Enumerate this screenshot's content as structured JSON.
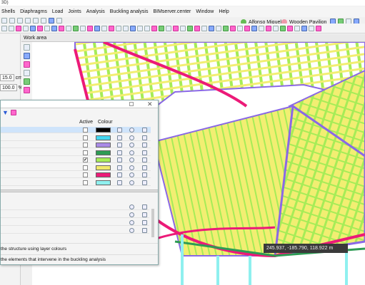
{
  "app": {
    "title_fragment": "3D)"
  },
  "menu": [
    "Shells",
    "Diaphragms",
    "Load",
    "Joints",
    "Analysis",
    "Buckling analysis",
    "BIMserver.center",
    "Window",
    "Help"
  ],
  "users": [
    {
      "name": "Alfonso Miguel",
      "color": "#7c6"
    },
    {
      "name": "Wooden Pavilion",
      "color": "#e9a"
    }
  ],
  "workarea": {
    "label": "Work area"
  },
  "left_fields": {
    "value1": "15.0",
    "unit1": "cm",
    "value2": "100.0",
    "unit2": "%"
  },
  "dialog": {
    "columns": {
      "active": "Active",
      "colour": "Colour"
    },
    "layers": [
      {
        "active": false,
        "colour": "#000000",
        "selected": true
      },
      {
        "active": false,
        "colour": "#44d6f0"
      },
      {
        "active": false,
        "colour": "#a98ae6"
      },
      {
        "active": false,
        "colour": "#2e9b54"
      },
      {
        "active": true,
        "colour": "#a6ec57"
      },
      {
        "active": false,
        "colour": "#f0e96c"
      },
      {
        "active": false,
        "colour": "#ec1a78"
      },
      {
        "active": false,
        "colour": "#8ff0ef"
      }
    ],
    "option1": "the structure using layer colours",
    "option2": "the elements that intervene in the buckling analysis"
  },
  "coordinates": {
    "text": "245.937, -185.790, 118.922 m"
  }
}
